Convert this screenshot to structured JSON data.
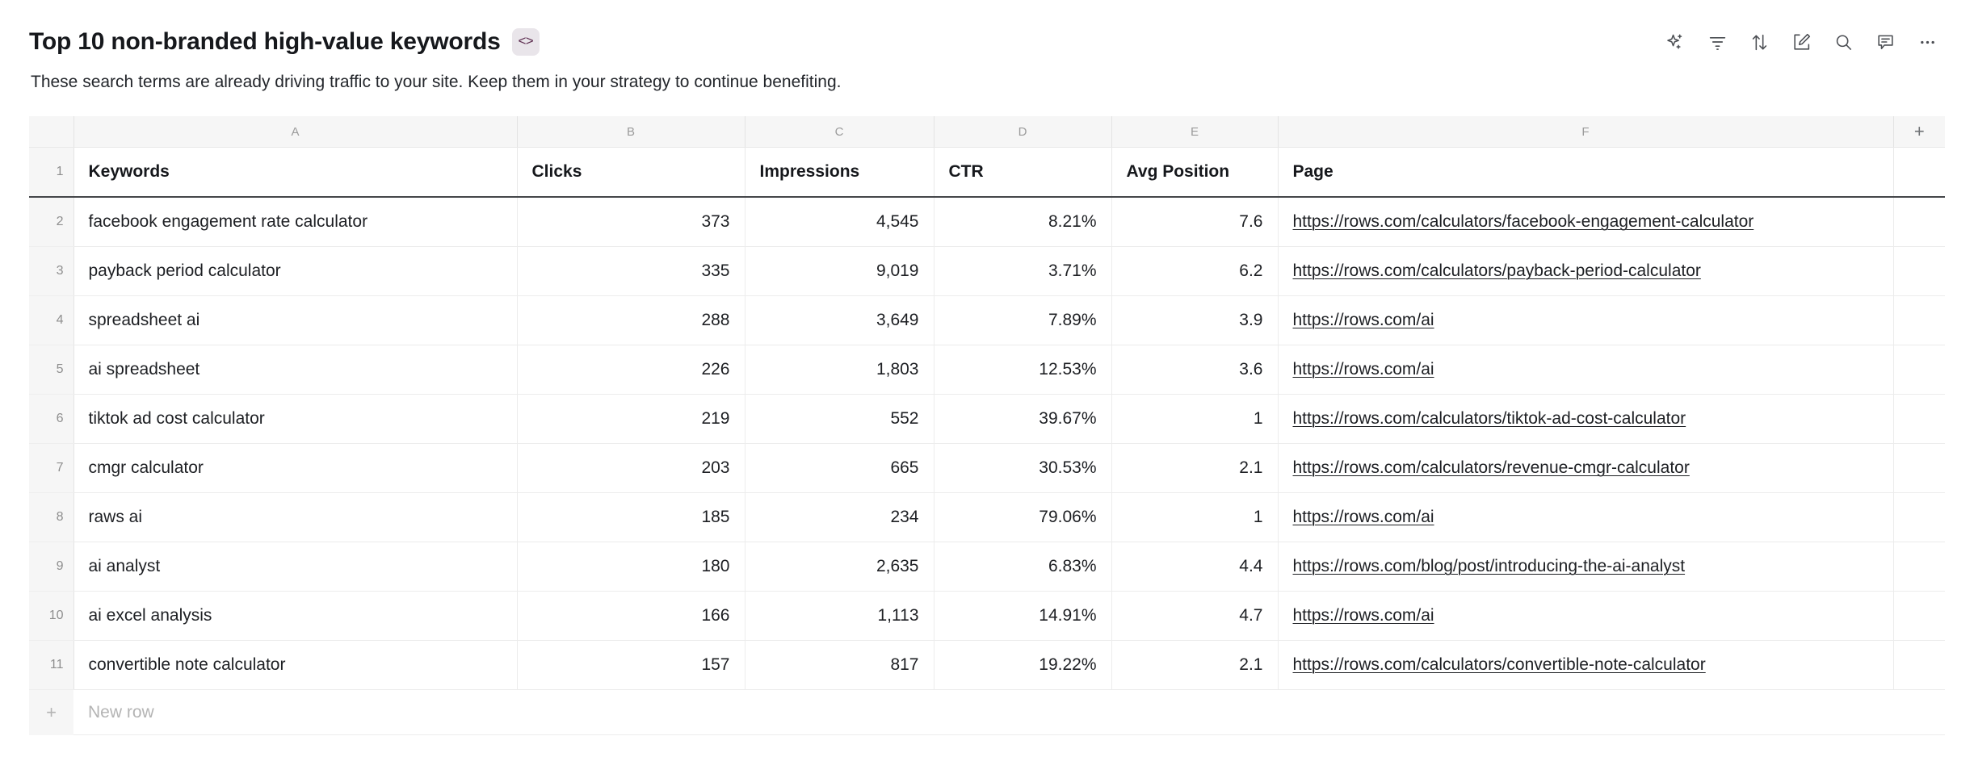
{
  "header": {
    "title": "Top 10 non-branded high-value keywords",
    "code_badge": "<>",
    "subtitle": "These search terms are already driving traffic to your site. Keep them in your strategy to continue benefiting."
  },
  "toolbar": {
    "items": [
      {
        "name": "ai-sparkle-icon",
        "label": "AI"
      },
      {
        "name": "filter-icon",
        "label": "Filter"
      },
      {
        "name": "sort-icon",
        "label": "Sort"
      },
      {
        "name": "edit-icon",
        "label": "Edit"
      },
      {
        "name": "search-icon",
        "label": "Search"
      },
      {
        "name": "comment-icon",
        "label": "Comment"
      },
      {
        "name": "more-icon",
        "label": "More"
      }
    ]
  },
  "sheet": {
    "column_letters": [
      "A",
      "B",
      "C",
      "D",
      "E",
      "F"
    ],
    "add_column_label": "+",
    "header_row_number": "1",
    "headers": [
      "Keywords",
      "Clicks",
      "Impressions",
      "CTR",
      "Avg Position",
      "Page"
    ],
    "new_row": {
      "plus": "+",
      "label": "New row"
    },
    "rows": [
      {
        "n": "2",
        "keyword": "facebook engagement rate calculator",
        "clicks": "373",
        "impressions": "4,545",
        "ctr": "8.21%",
        "avg_position": "7.6",
        "page": "https://rows.com/calculators/facebook-engagement-calculator"
      },
      {
        "n": "3",
        "keyword": "payback period calculator",
        "clicks": "335",
        "impressions": "9,019",
        "ctr": "3.71%",
        "avg_position": "6.2",
        "page": "https://rows.com/calculators/payback-period-calculator"
      },
      {
        "n": "4",
        "keyword": "spreadsheet ai",
        "clicks": "288",
        "impressions": "3,649",
        "ctr": "7.89%",
        "avg_position": "3.9",
        "page": "https://rows.com/ai"
      },
      {
        "n": "5",
        "keyword": "ai spreadsheet",
        "clicks": "226",
        "impressions": "1,803",
        "ctr": "12.53%",
        "avg_position": "3.6",
        "page": "https://rows.com/ai"
      },
      {
        "n": "6",
        "keyword": "tiktok ad cost calculator",
        "clicks": "219",
        "impressions": "552",
        "ctr": "39.67%",
        "avg_position": "1",
        "page": "https://rows.com/calculators/tiktok-ad-cost-calculator"
      },
      {
        "n": "7",
        "keyword": "cmgr calculator",
        "clicks": "203",
        "impressions": "665",
        "ctr": "30.53%",
        "avg_position": "2.1",
        "page": "https://rows.com/calculators/revenue-cmgr-calculator"
      },
      {
        "n": "8",
        "keyword": "raws ai",
        "clicks": "185",
        "impressions": "234",
        "ctr": "79.06%",
        "avg_position": "1",
        "page": "https://rows.com/ai"
      },
      {
        "n": "9",
        "keyword": "ai analyst",
        "clicks": "180",
        "impressions": "2,635",
        "ctr": "6.83%",
        "avg_position": "4.4",
        "page": "https://rows.com/blog/post/introducing-the-ai-analyst"
      },
      {
        "n": "10",
        "keyword": "ai excel analysis",
        "clicks": "166",
        "impressions": "1,113",
        "ctr": "14.91%",
        "avg_position": "4.7",
        "page": "https://rows.com/ai"
      },
      {
        "n": "11",
        "keyword": "convertible note calculator",
        "clicks": "157",
        "impressions": "817",
        "ctr": "19.22%",
        "avg_position": "2.1",
        "page": "https://rows.com/calculators/convertible-note-calculator"
      }
    ]
  },
  "colors": {
    "badge_bg": "#e9e5ea",
    "badge_fg": "#5c2c4f",
    "gutter_bg": "#f6f6f6",
    "header_underline": "#444649",
    "muted_text": "#8e8e8e"
  }
}
